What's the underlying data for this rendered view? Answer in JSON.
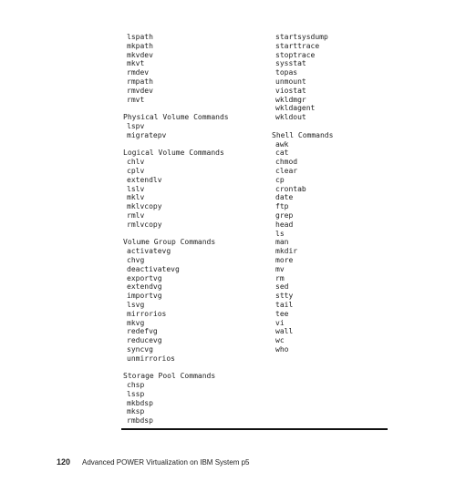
{
  "left_column": {
    "lead_items": [
      "lspath",
      "mkpath",
      "mkvdev",
      "mkvt",
      "rmdev",
      "rmpath",
      "rmvdev",
      "rmvt"
    ],
    "sections": [
      {
        "heading": "Physical Volume Commands",
        "items": [
          "lspv",
          "migratepv"
        ]
      },
      {
        "heading": "Logical Volume Commands",
        "items": [
          "chlv",
          "cplv",
          "extendlv",
          "lslv",
          "mklv",
          "mklvcopy",
          "rmlv",
          "rmlvcopy"
        ]
      },
      {
        "heading": "Volume Group Commands",
        "items": [
          "activatevg",
          "chvg",
          "deactivatevg",
          "exportvg",
          "extendvg",
          "importvg",
          "lsvg",
          "mirrorios",
          "mkvg",
          "redefvg",
          "reducevg",
          "syncvg",
          "unmirrorios"
        ]
      },
      {
        "heading": "Storage Pool Commands",
        "items": [
          "chsp",
          "lssp",
          "mkbdsp",
          "mksp",
          "rmbdsp"
        ]
      }
    ]
  },
  "right_column": {
    "lead_items": [
      "startsysdump",
      "starttrace",
      "stoptrace",
      "sysstat",
      "topas",
      "unmount",
      "viostat",
      "wkldmgr",
      "wkldagent",
      "wkldout"
    ],
    "sections": [
      {
        "heading": "Shell Commands",
        "items": [
          "awk",
          "cat",
          "chmod",
          "clear",
          "cp",
          "crontab",
          "date",
          "ftp",
          "grep",
          "head",
          "ls",
          "man",
          "mkdir",
          "more",
          "mv",
          "rm",
          "sed",
          "stty",
          "tail",
          "tee",
          "vi",
          "wall",
          "wc",
          "who"
        ]
      }
    ]
  },
  "footer": {
    "page_number": "120",
    "book_title": "Advanced POWER Virtualization on IBM System p5"
  }
}
